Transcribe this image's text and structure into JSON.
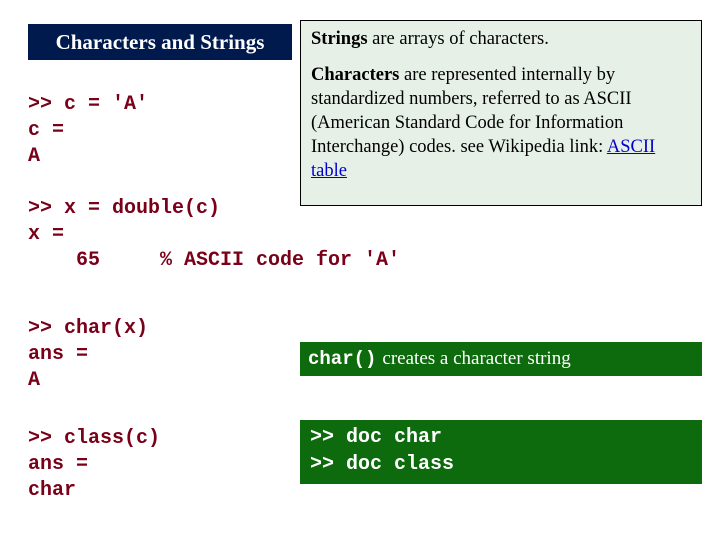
{
  "title": "Characters and Strings",
  "info": {
    "p1_strong": "Strings",
    "p1_rest": " are arrays of characters.",
    "p2_strong": "Characters",
    "p2_rest_a": " are represented internally by standardized numbers, referred to as ASCII (American Standard Code for Information Interchange) codes. see Wikipedia link: ",
    "p2_link": "ASCII table"
  },
  "code1": ">> c = 'A'\nc =\nA\n\n>> x = double(c)\nx =\n    65     % ASCII code for 'A'",
  "code2": ">> char(x)\nans =\nA",
  "code3": ">> class(c)\nans =\nchar",
  "greenbox1": {
    "func": "char()",
    "rest": " creates a character string"
  },
  "greenbox2": ">> doc char\n>> doc class"
}
